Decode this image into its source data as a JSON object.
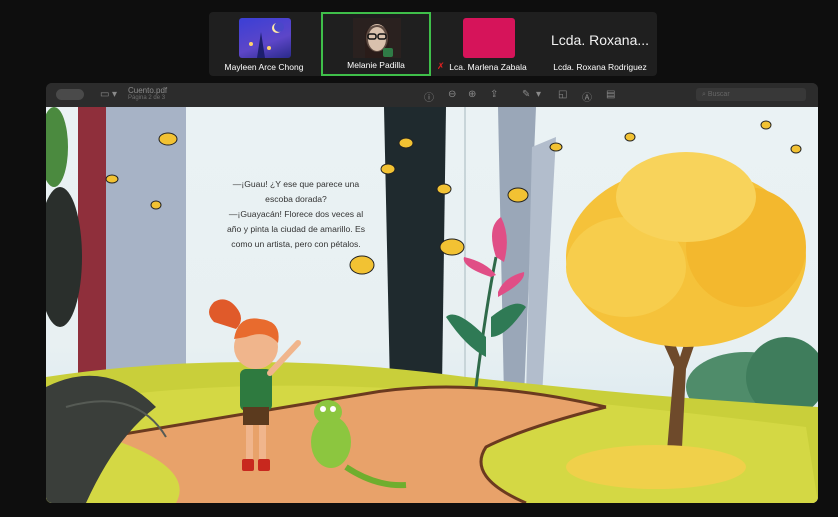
{
  "participants": [
    {
      "name": "Mayleen Arce Chong"
    },
    {
      "name": "Melanie Padilla"
    },
    {
      "name": "Lca. Marlena Zabala"
    },
    {
      "name": "Lcda. Roxana Rodriguez",
      "display": "Lcda. Roxana..."
    }
  ],
  "viewer": {
    "title": "Cuento.pdf",
    "subtitle": "Página 2 de 3",
    "search_placeholder": "Buscar"
  },
  "story": {
    "line1": "—¡Guau! ¿Y ese que parece una",
    "line2": "escoba dorada?",
    "line3": "—¡Guayacán! Florece dos veces al",
    "line4": "año y pinta la ciudad de amarillo. Es",
    "line5": "como un artista, pero con pétalos."
  },
  "colors": {
    "active_speaker": "#3fbf4a",
    "tree_yellow": "#f5c23a",
    "path_orange": "#e8a26a",
    "grass": "#c9cf3a"
  }
}
